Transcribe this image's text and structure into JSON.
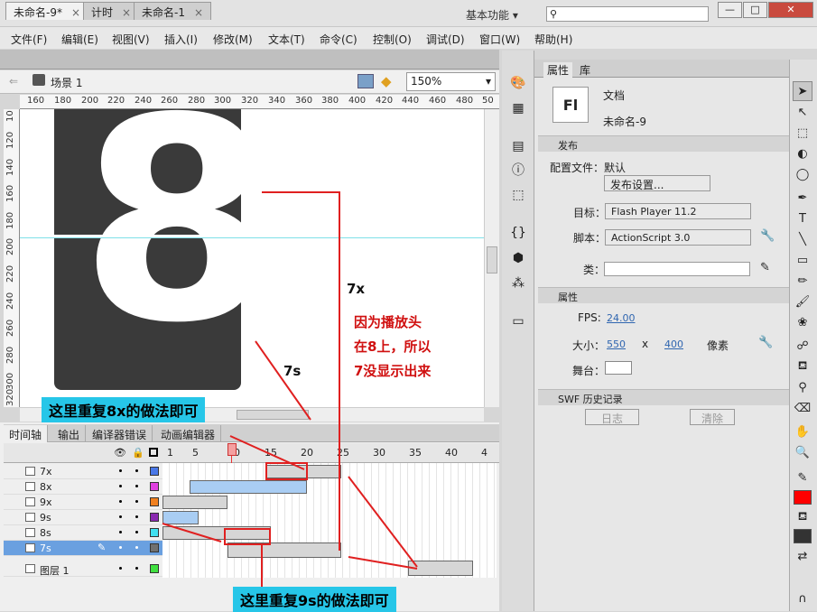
{
  "app": {
    "logo": "Fl",
    "workspace": "基本功能"
  },
  "window": {
    "minimize": "—",
    "maximize": "□",
    "close": "✕"
  },
  "menu": [
    "文件(F)",
    "编辑(E)",
    "视图(V)",
    "插入(I)",
    "修改(M)",
    "文本(T)",
    "命令(C)",
    "控制(O)",
    "调试(D)",
    "窗口(W)",
    "帮助(H)"
  ],
  "doc_tabs": [
    {
      "label": "未命名-9*",
      "active": true
    },
    {
      "label": "计时",
      "active": false
    },
    {
      "label": "未命名-1",
      "active": false
    }
  ],
  "editbar": {
    "scene": "场景 1",
    "zoom": "150%"
  },
  "ruler_top": [
    "160",
    "180",
    "200",
    "220",
    "240",
    "260",
    "280",
    "300",
    "320",
    "340",
    "360",
    "380",
    "400",
    "420",
    "440",
    "460",
    "480",
    "50"
  ],
  "ruler_left": [
    "10",
    "120",
    "140",
    "160",
    "180",
    "200",
    "220",
    "240",
    "260",
    "280",
    "300",
    "320"
  ],
  "timeline": {
    "tabs": [
      "时间轴",
      "输出",
      "编译器错误",
      "动画编辑器"
    ],
    "frame_numbers": [
      "1",
      "5",
      "10",
      "15",
      "20",
      "25",
      "30",
      "35",
      "40",
      "4"
    ],
    "layers": [
      {
        "name": "7x",
        "color": "#4a78e8",
        "selected": false
      },
      {
        "name": "8x",
        "color": "#e040e0",
        "selected": false
      },
      {
        "name": "9x",
        "color": "#f08020",
        "selected": false
      },
      {
        "name": "9s",
        "color": "#8a2ab0",
        "selected": false
      },
      {
        "name": "8s",
        "color": "#40e0f0",
        "selected": false
      },
      {
        "name": "7s",
        "color": "#707070",
        "selected": true
      },
      {
        "name": "图层 1",
        "color": "#40e040",
        "selected": false
      }
    ]
  },
  "props": {
    "tabs": [
      "属性",
      "库"
    ],
    "doc_icon": "Fl",
    "doc_type": "文档",
    "doc_name": "未命名-9",
    "publish_section": "发布",
    "profile_label": "配置文件：默认",
    "publish_settings": "发布设置...",
    "target_label": "目标：",
    "target_value": "Flash Player 11.2",
    "script_label": "脚本：",
    "script_value": "ActionScript 3.0",
    "class_label": "类：",
    "props_section": "属性",
    "fps_label": "FPS:",
    "fps_value": "24.00",
    "size_label": "大小：",
    "width": "550",
    "x": "x",
    "height": "400",
    "unit": "像素",
    "stage_label": "舞台：",
    "swf_section": "SWF 历史记录",
    "log_button": "日志",
    "clear_button": "清除"
  },
  "annotations": {
    "note_7x": "7x",
    "note_7s": "7s",
    "note_reason": [
      "因为播放头",
      "在8上，所以",
      "7没显示出来"
    ],
    "callout_top": "这里重复8x的做法即可",
    "callout_bottom": "这里重复9s的做法即可"
  },
  "stage_digit": "8"
}
